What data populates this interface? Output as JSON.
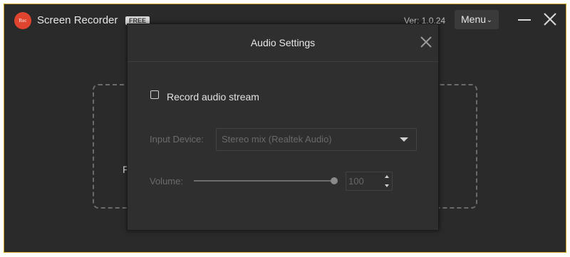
{
  "app": {
    "logo_text": "Rec",
    "title": "Screen Recorder",
    "badge": "FREE",
    "version": "Ver: 1.0.24",
    "menu_label": "Menu"
  },
  "background": {
    "partial_text": "F"
  },
  "dialog": {
    "title": "Audio Settings",
    "record_audio": {
      "label": "Record audio stream",
      "checked": false
    },
    "input_device": {
      "label": "Input Device:",
      "value": "Stereo mix (Realtek Audio)"
    },
    "volume": {
      "label": "Volume:",
      "value": "100",
      "level": 1.0
    }
  },
  "colors": {
    "window_bg": "#2a2a2b",
    "dialog_bg": "#2f2f30",
    "accent_logo": "#e0442f",
    "border_highlight": "#c9a227"
  },
  "icons": {
    "close": "close-icon",
    "minimize": "minimize-icon",
    "chevron": "chevron-down-icon",
    "caret": "caret-down-icon"
  }
}
